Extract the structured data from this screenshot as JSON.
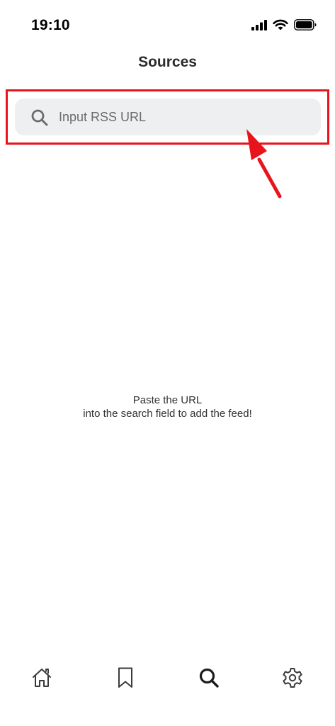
{
  "status_bar": {
    "time": "19:10",
    "icons": [
      "cellular-signal-icon",
      "wifi-icon",
      "battery-icon"
    ]
  },
  "header": {
    "title": "Sources"
  },
  "search": {
    "placeholder": "Input RSS URL",
    "value": "",
    "icon": "search-icon"
  },
  "annotation": {
    "highlight_color": "#e8141c"
  },
  "empty_state": {
    "line1": "Paste the URL",
    "line2": "into the search field to add the feed!"
  },
  "tab_bar": {
    "items": [
      {
        "icon": "home-icon",
        "active": false
      },
      {
        "icon": "bookmark-icon",
        "active": false
      },
      {
        "icon": "search-icon",
        "active": true
      },
      {
        "icon": "gear-icon",
        "active": false
      }
    ]
  }
}
